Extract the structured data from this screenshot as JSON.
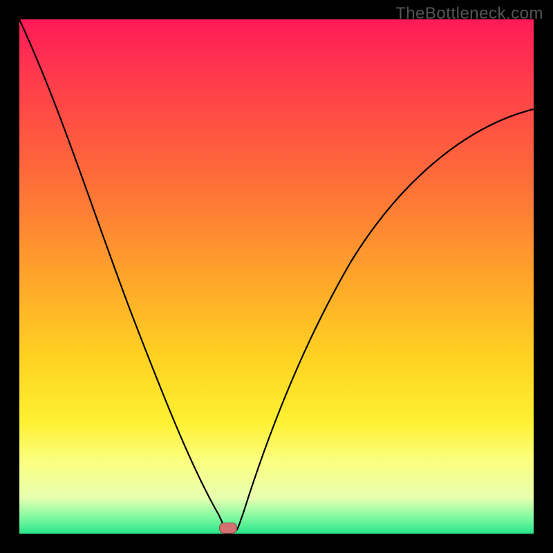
{
  "watermark": "TheBottleneck.com",
  "colors": {
    "background": "#000000",
    "gradient_top": "#ff1a58",
    "gradient_bottom": "#29e68a",
    "curve_stroke": "#000000",
    "marker_fill": "#d37070"
  },
  "chart_data": {
    "type": "line",
    "title": "",
    "xlabel": "",
    "ylabel": "",
    "xlim": [
      0,
      1
    ],
    "ylim": [
      0,
      1
    ],
    "notch_x": 0.405,
    "marker": {
      "x": 0.405,
      "y": 0.0
    },
    "series": [
      {
        "name": "curve",
        "x": [
          0.0,
          0.05,
          0.1,
          0.15,
          0.2,
          0.25,
          0.3,
          0.35,
          0.38,
          0.395,
          0.405,
          0.415,
          0.43,
          0.5,
          0.6,
          0.7,
          0.8,
          0.9,
          1.0
        ],
        "values": [
          1.0,
          0.87,
          0.75,
          0.62,
          0.49,
          0.36,
          0.24,
          0.12,
          0.05,
          0.01,
          0.0,
          0.01,
          0.05,
          0.28,
          0.5,
          0.63,
          0.72,
          0.78,
          0.82
        ]
      }
    ]
  }
}
